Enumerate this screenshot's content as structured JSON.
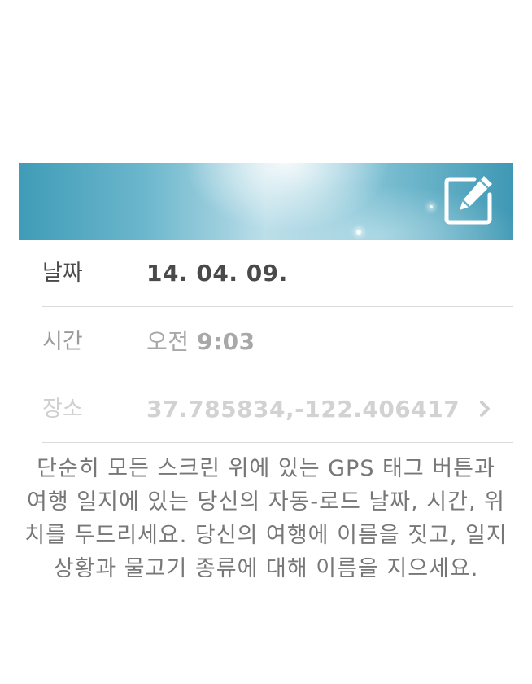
{
  "header": {
    "edit_icon": "edit-icon",
    "colors": {
      "sky_dark": "#3f9cb7",
      "sky_light": "#b9dde8"
    }
  },
  "details": {
    "date": {
      "label": "날짜",
      "value": "14. 04. 09."
    },
    "time": {
      "label": "시간",
      "period": "오전",
      "clock": "9:03"
    },
    "place": {
      "label": "장소",
      "value": "37.785834,-122.406417",
      "chevron_icon": "chevron-right-icon"
    }
  },
  "instructions": {
    "text": "단순히 모든 스크린 위에 있는 GPS 태그 버튼과 여행 일지에 있는 당신의 자동-로드 날짜, 시간, 위치를 두드리세요. 당신의 여행에 이름을 짓고, 일지 상황과 물고기 종류에 대해 이름을 지으세요."
  }
}
